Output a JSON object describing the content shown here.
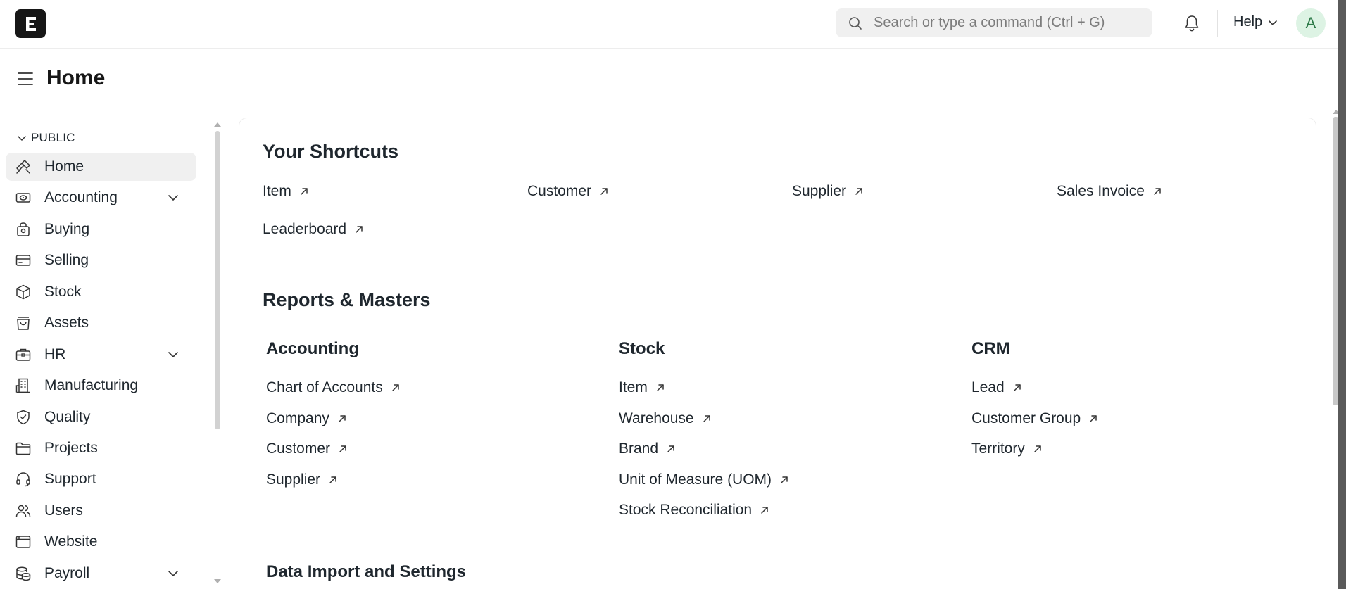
{
  "navbar": {
    "logo_letter": "E",
    "search_placeholder": "Search or type a command (Ctrl + G)",
    "help_label": "Help",
    "avatar_initial": "A"
  },
  "page": {
    "title": "Home"
  },
  "sidebar": {
    "section_label": "PUBLIC",
    "items": [
      {
        "label": "Home",
        "icon": "tools-icon",
        "active": true,
        "expandable": false
      },
      {
        "label": "Accounting",
        "icon": "money-icon",
        "active": false,
        "expandable": true
      },
      {
        "label": "Buying",
        "icon": "bag-icon",
        "active": false,
        "expandable": false
      },
      {
        "label": "Selling",
        "icon": "card-icon",
        "active": false,
        "expandable": false
      },
      {
        "label": "Stock",
        "icon": "box-icon",
        "active": false,
        "expandable": false
      },
      {
        "label": "Assets",
        "icon": "shopping-bag-icon",
        "active": false,
        "expandable": false
      },
      {
        "label": "HR",
        "icon": "briefcase-icon",
        "active": false,
        "expandable": true
      },
      {
        "label": "Manufacturing",
        "icon": "building-icon",
        "active": false,
        "expandable": false
      },
      {
        "label": "Quality",
        "icon": "shield-icon",
        "active": false,
        "expandable": false
      },
      {
        "label": "Projects",
        "icon": "folder-icon",
        "active": false,
        "expandable": false
      },
      {
        "label": "Support",
        "icon": "headset-icon",
        "active": false,
        "expandable": false
      },
      {
        "label": "Users",
        "icon": "users-icon",
        "active": false,
        "expandable": false
      },
      {
        "label": "Website",
        "icon": "browser-icon",
        "active": false,
        "expandable": false
      },
      {
        "label": "Payroll",
        "icon": "coins-icon",
        "active": false,
        "expandable": true
      }
    ]
  },
  "shortcuts": {
    "title": "Your Shortcuts",
    "items": [
      "Item",
      "Customer",
      "Supplier",
      "Sales Invoice",
      "Leaderboard"
    ]
  },
  "reports": {
    "title": "Reports & Masters",
    "columns": [
      {
        "title": "Accounting",
        "links": [
          "Chart of Accounts",
          "Company",
          "Customer",
          "Supplier"
        ]
      },
      {
        "title": "Stock",
        "links": [
          "Item",
          "Warehouse",
          "Brand",
          "Unit of Measure (UOM)",
          "Stock Reconciliation"
        ]
      },
      {
        "title": "CRM",
        "links": [
          "Lead",
          "Customer Group",
          "Territory"
        ]
      }
    ],
    "next_section_title": "Data Import and Settings"
  }
}
